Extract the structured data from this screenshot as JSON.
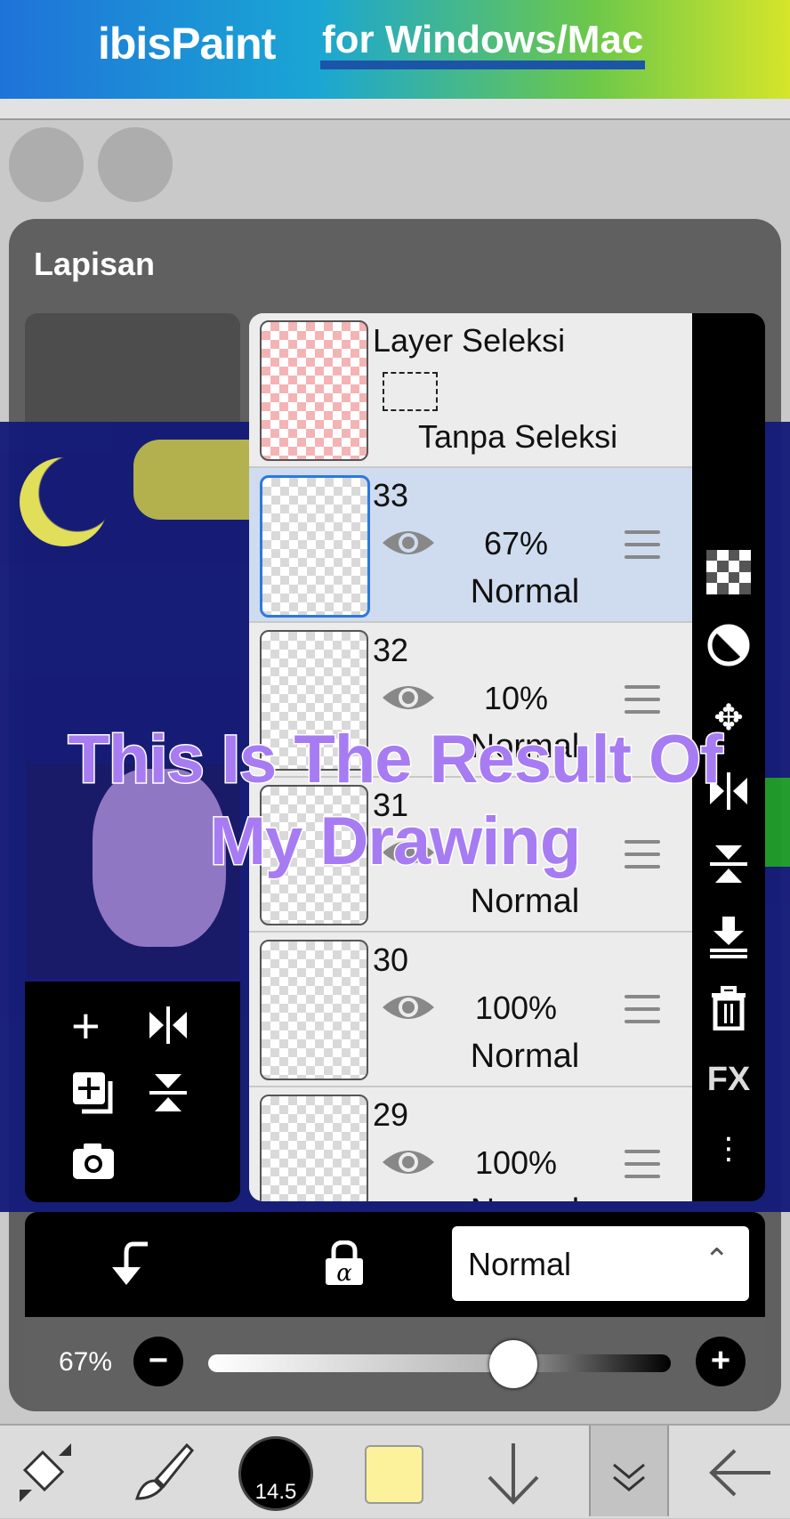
{
  "banner": {
    "brand": "ibisPaint",
    "tagline": "for Windows/Mac"
  },
  "panel": {
    "title": "Lapisan"
  },
  "selection_layer": {
    "title": "Layer Seleksi",
    "status": "Tanpa Seleksi"
  },
  "layers": [
    {
      "number": "33",
      "opacity": "67%",
      "blend": "Normal",
      "selected": true
    },
    {
      "number": "32",
      "opacity": "10%",
      "blend": "Normal",
      "selected": false
    },
    {
      "number": "31",
      "opacity": "",
      "blend": "Normal",
      "selected": false
    },
    {
      "number": "30",
      "opacity": "100%",
      "blend": "Normal",
      "selected": false
    },
    {
      "number": "29",
      "opacity": "100%",
      "blend": "Normal",
      "selected": false
    }
  ],
  "side_tools": [
    "checker-icon",
    "half-circle-icon",
    "move-icon",
    "flip-horizontal-icon",
    "flip-vertical-icon",
    "merge-down-icon",
    "trash-icon",
    "FX",
    "more-icon"
  ],
  "bottom": {
    "blend_mode": "Normal",
    "opacity_label": "67%",
    "opacity_value": 0.67
  },
  "toolbar": {
    "brush_size": "14.5",
    "color": "#fdf29c"
  },
  "caption": {
    "line1": "This Is The Result Of",
    "line2": "My Drawing"
  }
}
